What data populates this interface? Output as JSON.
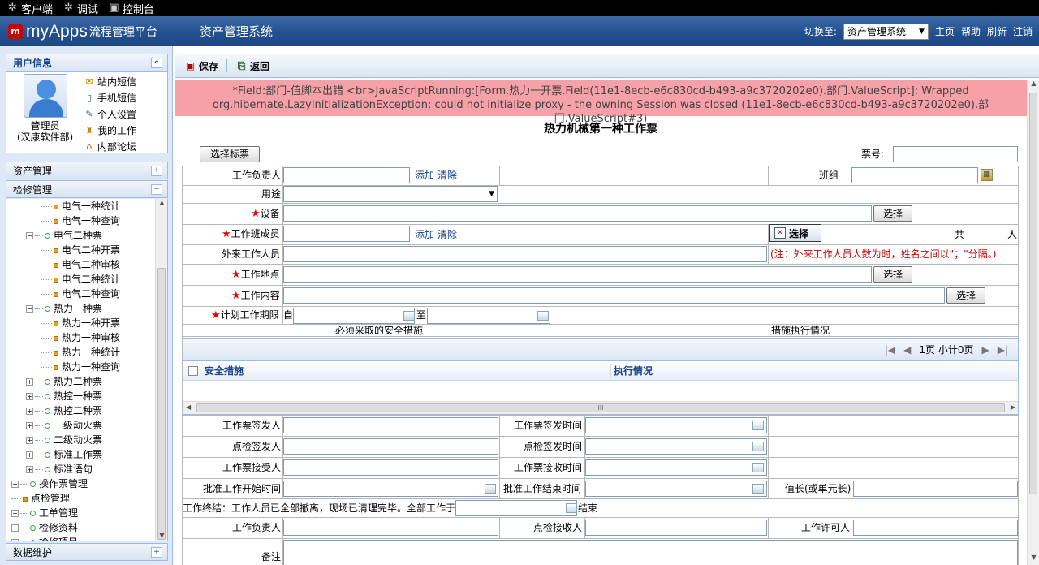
{
  "topbar": {
    "items": [
      {
        "icon": "gear-icon",
        "label": "客户端"
      },
      {
        "icon": "gear-icon",
        "label": "调试"
      },
      {
        "icon": "monitor-icon",
        "label": "控制台"
      }
    ]
  },
  "header": {
    "brand": "myApps",
    "brand_sub": "流程管理平台",
    "system_title": "资产管理系统",
    "switch_label": "切换至:",
    "switch_value": "资产管理系统",
    "links": [
      "主页",
      "帮助",
      "刷新",
      "注销"
    ]
  },
  "user": {
    "panel_title": "用户信息",
    "name": "管理员",
    "dept": "(汉康软件部)",
    "links": [
      {
        "icon": "mail-icon",
        "label": "站内短信"
      },
      {
        "icon": "phone-icon",
        "label": "手机短信"
      },
      {
        "icon": "edit-icon",
        "label": "个人设置"
      },
      {
        "icon": "work-icon",
        "label": "我的工作"
      },
      {
        "icon": "home-icon",
        "label": "内部论坛"
      }
    ]
  },
  "accordion": {
    "asset": "资产管理",
    "maint": "检修管理",
    "data": "数据维护"
  },
  "tree": [
    {
      "level": 2,
      "type": "leaf",
      "label": "电气一种统计"
    },
    {
      "level": 2,
      "type": "leaf",
      "label": "电气一种查询"
    },
    {
      "level": 1,
      "type": "open",
      "label": "电气二种票"
    },
    {
      "level": 2,
      "type": "leaf",
      "label": "电气二种开票"
    },
    {
      "level": 2,
      "type": "leaf",
      "label": "电气二种审核"
    },
    {
      "level": 2,
      "type": "leaf",
      "label": "电气二种统计"
    },
    {
      "level": 2,
      "type": "leaf",
      "label": "电气二种查询"
    },
    {
      "level": 1,
      "type": "open",
      "label": "热力一种票"
    },
    {
      "level": 2,
      "type": "leaf",
      "label": "热力一种开票"
    },
    {
      "level": 2,
      "type": "leaf",
      "label": "热力一种审核"
    },
    {
      "level": 2,
      "type": "leaf",
      "label": "热力一种统计"
    },
    {
      "level": 2,
      "type": "leaf",
      "label": "热力一种查询"
    },
    {
      "level": 1,
      "type": "closed",
      "label": "热力二种票"
    },
    {
      "level": 1,
      "type": "closed",
      "label": "热控一种票"
    },
    {
      "level": 1,
      "type": "closed",
      "label": "热控二种票"
    },
    {
      "level": 1,
      "type": "closed",
      "label": "一级动火票"
    },
    {
      "level": 1,
      "type": "closed",
      "label": "二级动火票"
    },
    {
      "level": 1,
      "type": "closed",
      "label": "标准工作票"
    },
    {
      "level": 1,
      "type": "closed",
      "label": "标准语句"
    },
    {
      "level": 0,
      "type": "closed",
      "label": "操作票管理"
    },
    {
      "level": 0,
      "type": "leaf",
      "label": "点检管理"
    },
    {
      "level": 0,
      "type": "closed",
      "label": "工单管理"
    },
    {
      "level": 0,
      "type": "closed",
      "label": "检修资料"
    },
    {
      "level": 0,
      "type": "closed",
      "label": "检修项目"
    }
  ],
  "toolbar": {
    "save": "保存",
    "back": "返回"
  },
  "error": {
    "line1": "*Field:部门-值脚本出错 <br>JavaScriptRunning:[Form.热力一开票.Field(11e1-8ecb-e6c830cd-b493-a9c3720202e0).部门.ValueScript]: Wrapped",
    "line2": "org.hibernate.LazyInitializationException: could not initialize proxy - the owning Session was closed (11e1-8ecb-e6c830cd-b493-a9c3720202e0).部门.ValueScript#3)"
  },
  "form": {
    "title": "热力机械第一种工作票",
    "select_ticket": "选择标票",
    "ticket_no": "票号:",
    "work_leader": "工作负责人",
    "add": "添加",
    "clear": "清除",
    "team": "班组",
    "purpose": "用途",
    "equipment": "设备",
    "choose": "选择",
    "members": "工作班成员",
    "total_prefix": "共",
    "total_suffix": "人",
    "outsiders": "外来工作人员",
    "outsiders_note": "(注：外来工作人员人数为时，姓名之间以\"；\"分隔。)",
    "location": "工作地点",
    "content": "工作内容",
    "period": "计划工作期限",
    "from": "自",
    "to": "至",
    "measures_col": "必须采取的安全措施",
    "exec_col": "措施执行情况",
    "grid_paging": "1页 小计0页",
    "grid_col1": "安全措施",
    "grid_col2": "执行情况",
    "issuer": "工作票签发人",
    "issue_time": "工作票签发时间",
    "checker": "点检签发人",
    "check_time": "点检签发时间",
    "receiver": "工作票接受人",
    "receive_time": "工作票接收时间",
    "approve_start": "批准工作开始时间",
    "approve_end": "批准工作结束时间",
    "shift_leader": "值长(或单元长)",
    "end_text": "工作终结：工作人员已全部撤离，现场已清理完毕。全部工作于",
    "end_suffix": "结束",
    "leader2": "工作负责人",
    "check_receiver": "点检接收人",
    "permitter": "工作许可人",
    "remark": "备注"
  }
}
